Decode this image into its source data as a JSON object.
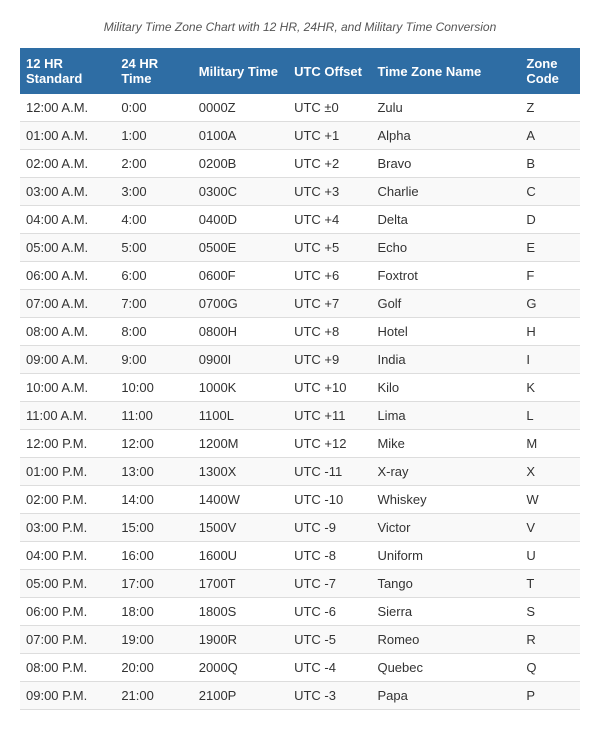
{
  "page": {
    "title": "Military Time Zone Chart with 12 HR, 24HR, and Military Time Conversion",
    "headers": {
      "col1": "12 HR Standard",
      "col2": "24 HR Time",
      "col3": "Military Time",
      "col4": "UTC Offset",
      "col5": "Time Zone Name",
      "col6": "Zone Code"
    },
    "rows": [
      {
        "hr12": "12:00 A.M.",
        "hr24": "0:00",
        "mil": "0000Z",
        "utc": "UTC ±0",
        "name": "Zulu",
        "code": "Z"
      },
      {
        "hr12": "01:00 A.M.",
        "hr24": "1:00",
        "mil": "0100A",
        "utc": "UTC +1",
        "name": "Alpha",
        "code": "A"
      },
      {
        "hr12": "02:00 A.M.",
        "hr24": "2:00",
        "mil": "0200B",
        "utc": "UTC +2",
        "name": "Bravo",
        "code": "B"
      },
      {
        "hr12": "03:00 A.M.",
        "hr24": "3:00",
        "mil": "0300C",
        "utc": "UTC +3",
        "name": "Charlie",
        "code": "C"
      },
      {
        "hr12": "04:00 A.M.",
        "hr24": "4:00",
        "mil": "0400D",
        "utc": "UTC +4",
        "name": "Delta",
        "code": "D"
      },
      {
        "hr12": "05:00 A.M.",
        "hr24": "5:00",
        "mil": "0500E",
        "utc": "UTC +5",
        "name": "Echo",
        "code": "E"
      },
      {
        "hr12": "06:00 A.M.",
        "hr24": "6:00",
        "mil": "0600F",
        "utc": "UTC +6",
        "name": "Foxtrot",
        "code": "F"
      },
      {
        "hr12": "07:00 A.M.",
        "hr24": "7:00",
        "mil": "0700G",
        "utc": "UTC +7",
        "name": "Golf",
        "code": "G"
      },
      {
        "hr12": "08:00 A.M.",
        "hr24": "8:00",
        "mil": "0800H",
        "utc": "UTC +8",
        "name": "Hotel",
        "code": "H"
      },
      {
        "hr12": "09:00 A.M.",
        "hr24": "9:00",
        "mil": "0900I",
        "utc": "UTC +9",
        "name": "India",
        "code": "I"
      },
      {
        "hr12": "10:00 A.M.",
        "hr24": "10:00",
        "mil": "1000K",
        "utc": "UTC +10",
        "name": "Kilo",
        "code": "K"
      },
      {
        "hr12": "11:00 A.M.",
        "hr24": "11:00",
        "mil": "1100L",
        "utc": "UTC +11",
        "name": "Lima",
        "code": "L"
      },
      {
        "hr12": "12:00 P.M.",
        "hr24": "12:00",
        "mil": "1200M",
        "utc": "UTC +12",
        "name": "Mike",
        "code": "M"
      },
      {
        "hr12": "01:00 P.M.",
        "hr24": "13:00",
        "mil": "1300X",
        "utc": "UTC -11",
        "name": "X-ray",
        "code": "X"
      },
      {
        "hr12": "02:00 P.M.",
        "hr24": "14:00",
        "mil": "1400W",
        "utc": "UTC -10",
        "name": "Whiskey",
        "code": "W"
      },
      {
        "hr12": "03:00 P.M.",
        "hr24": "15:00",
        "mil": "1500V",
        "utc": "UTC -9",
        "name": "Victor",
        "code": "V"
      },
      {
        "hr12": "04:00 P.M.",
        "hr24": "16:00",
        "mil": "1600U",
        "utc": "UTC -8",
        "name": "Uniform",
        "code": "U"
      },
      {
        "hr12": "05:00 P.M.",
        "hr24": "17:00",
        "mil": "1700T",
        "utc": "UTC -7",
        "name": "Tango",
        "code": "T"
      },
      {
        "hr12": "06:00 P.M.",
        "hr24": "18:00",
        "mil": "1800S",
        "utc": "UTC -6",
        "name": "Sierra",
        "code": "S"
      },
      {
        "hr12": "07:00 P.M.",
        "hr24": "19:00",
        "mil": "1900R",
        "utc": "UTC -5",
        "name": "Romeo",
        "code": "R"
      },
      {
        "hr12": "08:00 P.M.",
        "hr24": "20:00",
        "mil": "2000Q",
        "utc": "UTC -4",
        "name": "Quebec",
        "code": "Q"
      },
      {
        "hr12": "09:00 P.M.",
        "hr24": "21:00",
        "mil": "2100P",
        "utc": "UTC -3",
        "name": "Papa",
        "code": "P"
      }
    ]
  }
}
